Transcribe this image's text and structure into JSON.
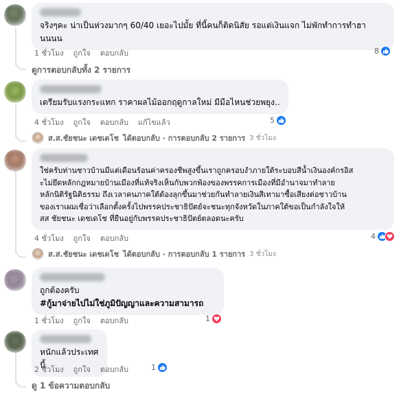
{
  "comments": [
    {
      "text": "จริงๆคะ น่าเป็นห่วงมากๆ 60/40 เยอะไปมั้ย ที่นี้คนก็ติดนิสัย รอแต่เงินแจก ไม่พักทำการทำฮา\nนนนน",
      "time": "1 ชั่วโมง",
      "like": "ถูกใจ",
      "reply": "ตอบกลับ",
      "reaction_count": "8",
      "view_replies": "ดูการตอบกลับทั้ง 2 รายการ"
    },
    {
      "text": "เตรียมรับแรงกระแทก ราคาผลไม้ออกฤดูกาลใหม่ มีมือไหนช่วยพยุง..",
      "time": "4 ชั่วโมง",
      "like": "ถูกใจ",
      "reply": "ตอบกลับ",
      "edited": "แก้ไขแล้ว",
      "reaction_count": "5",
      "reply_summary": {
        "name": "ส.ส.ชัยชนะ เดชเดโช",
        "text": "ได้ตอบกลับ · การตอบกลับ 2 รายการ",
        "time": "3 ชั่วโมง"
      }
    },
    {
      "text": "ใช่ครับท่านชาวบ้านมีแต่เดือนร้อนค่าครองชีพสูงขึ้นเราถูกครอบงำภายใต้ระบอบสีน้ำเงินองค์กรอิส\nะไม่ยึดหลักกฎหมายบ้านเมืองที่แท้จริงเห็นกับพวกพ้องของพรรคการเมืองที่มีอำนาจมาทำลาย\nหลักนิติรัฐนิติธรรม ถึงเวลาคนภาคใต้ต้องลุกขึ้นมาช่วยกันทำลายเงินสีเทามาซื้อเสียงต่อชาวบ้าน\nของเราเผมเชื่อว่าเลือกตั้งครั้งไปพรรคประชาธิปัตย์จะชนะทุกจังหวัดในภาคใต้ขอเป็นกำลังใจให้\nสส ชัยชนะ เดชเดโช ที่ยืนอยู่กับพรรคประชาธิปัตย์ตลอดนะครับ",
      "time": "4 ชั่วโมง",
      "like": "ถูกใจ",
      "reply": "ตอบกลับ",
      "reaction_count": "4",
      "reply_summary": {
        "name": "ส.ส.ชัยชนะ เดชเดโช",
        "text": "ได้ตอบกลับ · การตอบกลับ 1 รายการ",
        "time": "3 ชั่วโมง"
      }
    },
    {
      "text": "ถูกต้องครับ",
      "hashtag": "#กู้มาจ่ายไปไม่ใช่ภูมิปัญญาและความสามารถ",
      "time": "1 ชั่วโมง",
      "like": "ถูกใจ",
      "reply": "ตอบกลับ",
      "reaction_count": "1"
    },
    {
      "text": "หนักแล้วประเทศนี้",
      "time": "2 ชั่วโมง",
      "like": "ถูกใจ",
      "reply": "ตอบกลับ",
      "reaction_count": "1",
      "view_replies": "ดู 1 ข้อความตอบกลับ"
    }
  ],
  "icons": {
    "like": "thumbs-up-icon",
    "love": "heart-icon",
    "reply": "reply-arrow-icon"
  },
  "colors": {
    "like": "#1877f2",
    "love": "#f33e58",
    "bubble": "#f0f2f5",
    "meta": "#65676b"
  }
}
